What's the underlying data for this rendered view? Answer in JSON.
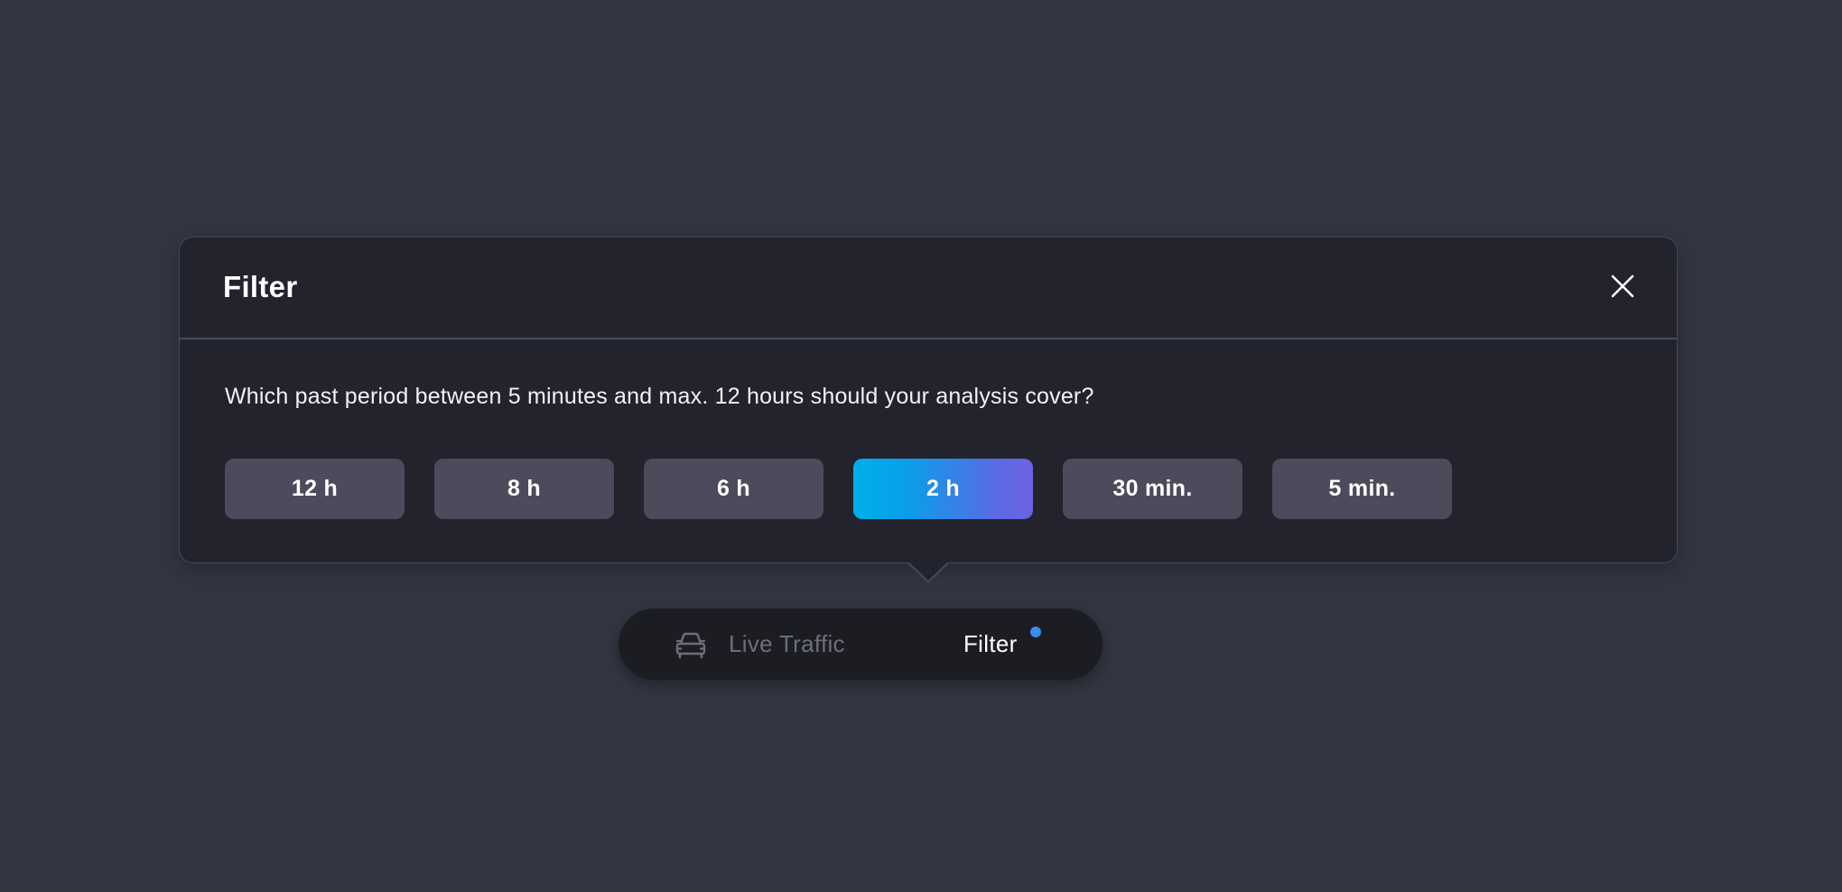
{
  "dialog": {
    "title": "Filter",
    "question": "Which past period between 5 minutes and max. 12 hours should your analysis cover?",
    "options": [
      {
        "label": "12 h",
        "selected": false
      },
      {
        "label": "8 h",
        "selected": false
      },
      {
        "label": "6 h",
        "selected": false
      },
      {
        "label": "2 h",
        "selected": true
      },
      {
        "label": "30 min.",
        "selected": false
      },
      {
        "label": "5 min.",
        "selected": false
      }
    ]
  },
  "toolbar": {
    "live_traffic_label": "Live Traffic",
    "live_traffic_icon": "car-icon",
    "filter_label": "Filter",
    "filter_icon": "sliders-icon",
    "filter_active": true
  },
  "colors": {
    "background": "#333542",
    "dialog": "#23232e",
    "option": "#4b4b5c",
    "selected_gradient_start": "#00b0ea",
    "selected_gradient_end": "#6c62e2",
    "notification_dot": "#3a8ef0"
  }
}
